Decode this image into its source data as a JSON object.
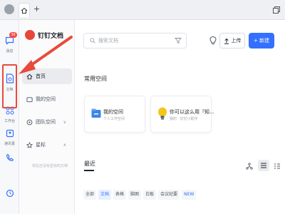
{
  "titlebar": {
    "home_icon": "home-icon",
    "add_icon": "plus-icon",
    "window_icon": "window-restore-icon"
  },
  "rail": {
    "items": [
      {
        "label": "消息",
        "icon": "chat-icon",
        "badge": "36"
      },
      {
        "label": "文档",
        "icon": "document-icon"
      },
      {
        "label": "工作台",
        "icon": "grid-icon"
      },
      {
        "label": "通讯录",
        "icon": "contacts-icon"
      },
      {
        "label": "",
        "icon": "phone-icon"
      },
      {
        "label": "",
        "icon": "clock-icon"
      }
    ],
    "highlight_color": "#e84a3c"
  },
  "sidebar": {
    "brand": "钉钉文档",
    "items": [
      {
        "label": "首页",
        "active": true
      },
      {
        "label": "我的空间"
      },
      {
        "label": "团队空间",
        "chevron": "∨"
      },
      {
        "label": "星标",
        "chevron": "∧"
      }
    ],
    "empty_text": "现在还没有星标的文档"
  },
  "main": {
    "search_placeholder": "搜索文档",
    "upload_label": "上传",
    "new_label": "+ 新建",
    "common_spaces_title": "常用空间",
    "cards": [
      {
        "title": "我的空间",
        "subtitle": "个人工作空间"
      },
      {
        "title": "你可以这么用『知...",
        "subtitle": "我的 · 钉钉小助手"
      }
    ],
    "recent_title": "最近",
    "chips": [
      {
        "label": "全部"
      },
      {
        "label": "文档",
        "active": true
      },
      {
        "label": "表格"
      },
      {
        "label": "脑图"
      },
      {
        "label": "白板"
      },
      {
        "label": "会议纪要"
      },
      {
        "label": "NEW",
        "new": true
      }
    ],
    "accent_color": "#3370ff"
  }
}
